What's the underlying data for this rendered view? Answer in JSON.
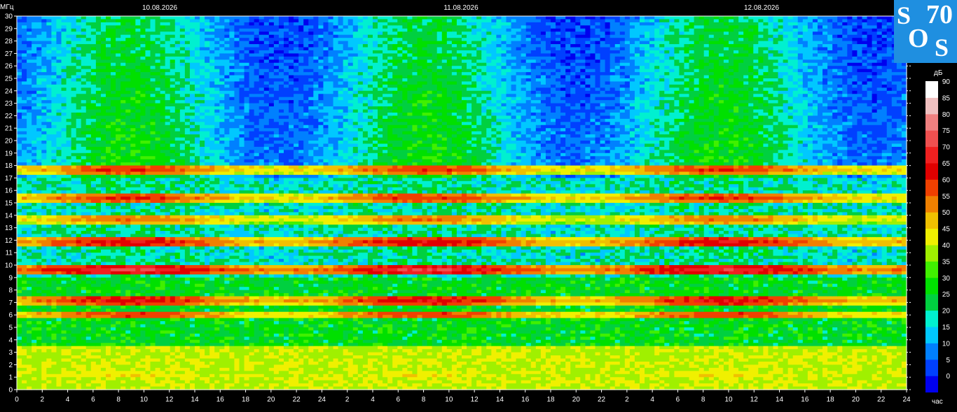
{
  "chart_data": {
    "type": "heatmap",
    "y_unit_label": "МГц",
    "x_unit_label": "час",
    "colorbar_unit_label": "дБ",
    "date_labels": [
      "10.08.2026",
      "11.08.2026",
      "12.08.2026"
    ],
    "ylim": [
      0,
      30
    ],
    "y_ticks": [
      0,
      1,
      2,
      3,
      4,
      5,
      6,
      7,
      8,
      9,
      10,
      11,
      12,
      13,
      14,
      15,
      16,
      17,
      18,
      19,
      20,
      21,
      22,
      23,
      24,
      25,
      26,
      27,
      28,
      29,
      30
    ],
    "x_ticks_hours": [
      "0",
      "2",
      "4",
      "6",
      "8",
      "10",
      "12",
      "14",
      "16",
      "18",
      "20",
      "22",
      "24",
      "2",
      "4",
      "6",
      "8",
      "10",
      "12",
      "14",
      "16",
      "18",
      "20",
      "22",
      "2",
      "4",
      "6",
      "8",
      "10",
      "12",
      "14",
      "16",
      "18",
      "20",
      "22",
      "24"
    ],
    "colorbar": {
      "range": [
        0,
        90
      ],
      "ticks": [
        0,
        5,
        10,
        15,
        20,
        25,
        30,
        35,
        40,
        45,
        50,
        55,
        60,
        65,
        70,
        75,
        80,
        85,
        90
      ],
      "colors": [
        "#0000ee",
        "#0040ff",
        "#0080ff",
        "#00c8ff",
        "#00f0d0",
        "#00d040",
        "#00e000",
        "#40f000",
        "#a0f000",
        "#f0f000",
        "#f0c000",
        "#f08000",
        "#f04000",
        "#e00000",
        "#f02020",
        "#f05050",
        "#f08080",
        "#f0c0c0",
        "#ffffff"
      ]
    },
    "bands_mhz": [
      {
        "freq": 1.2,
        "level": 45
      },
      {
        "freq": 6.0,
        "level": 60
      },
      {
        "freq": 7.2,
        "level": 65
      },
      {
        "freq": 9.6,
        "level": 70
      },
      {
        "freq": 11.8,
        "level": 65
      },
      {
        "freq": 13.7,
        "level": 55
      },
      {
        "freq": 15.4,
        "level": 60
      },
      {
        "freq": 17.7,
        "level": 60
      }
    ]
  },
  "logo": {
    "s1": "S",
    "num": "70",
    "o": "O",
    "s2": "S",
    "bg": "#1f8fe0"
  }
}
